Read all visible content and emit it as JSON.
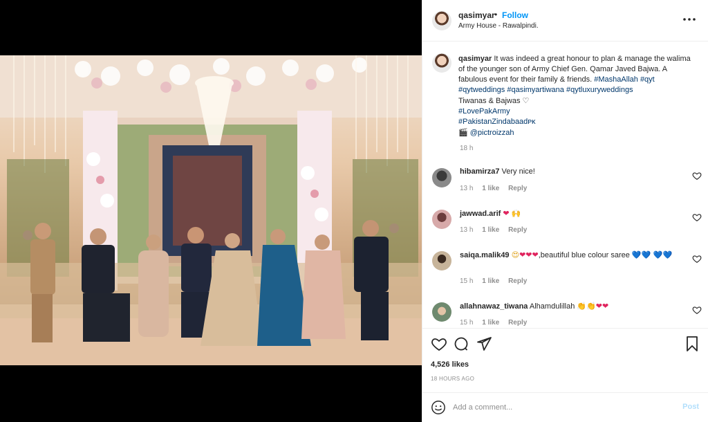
{
  "post": {
    "username": "qasimyar",
    "follow_label": "Follow",
    "separator": "•",
    "location": "Army House - Rawalpindi.",
    "more_icon": "more-horizontal-icon"
  },
  "caption": {
    "username": "qasimyar",
    "text": "It was indeed a great honour to plan & manage the walima of the younger son of Army Chief Gen. Qamar Javed Bajwa. A fabulous event for their family & friends.",
    "tags_line1": [
      "#MashaAllah",
      "#qyt"
    ],
    "tags_line2": [
      "#qytweddings",
      "#qasimyartiwana",
      "#qytluxuryweddings"
    ],
    "line_families": "Tiwanas & Bajwas",
    "tag_lovepakarmy": "#LovePakArmy",
    "tag_pakistan": "#PakistanZindabaadᴘᴋ",
    "credit": "@pictroizzah",
    "time": "18 h"
  },
  "comments": [
    {
      "username": "hibamirza7",
      "text": "Very nice!",
      "time": "13 h",
      "likes": "1 like",
      "reply": "Reply"
    },
    {
      "username": "jawwad.arif",
      "text": "",
      "time": "13 h",
      "likes": "1 like",
      "reply": "Reply"
    },
    {
      "username": "saiqa.malik49",
      "text": ",beautiful blue colour saree",
      "time": "15 h",
      "likes": "1 like",
      "reply": "Reply"
    },
    {
      "username": "allahnawaz_tiwana",
      "text": "Alhamdulillah",
      "time": "15 h",
      "likes": "1 like",
      "reply": "Reply"
    }
  ],
  "footer": {
    "likes": "4,526 likes",
    "timestamp": "18 HOURS AGO",
    "comment_placeholder": "Add a comment...",
    "post_label": "Post"
  },
  "colors": {
    "link": "#0095f6",
    "tag": "#00376b",
    "muted": "#8e8e8e",
    "text": "#262626"
  }
}
